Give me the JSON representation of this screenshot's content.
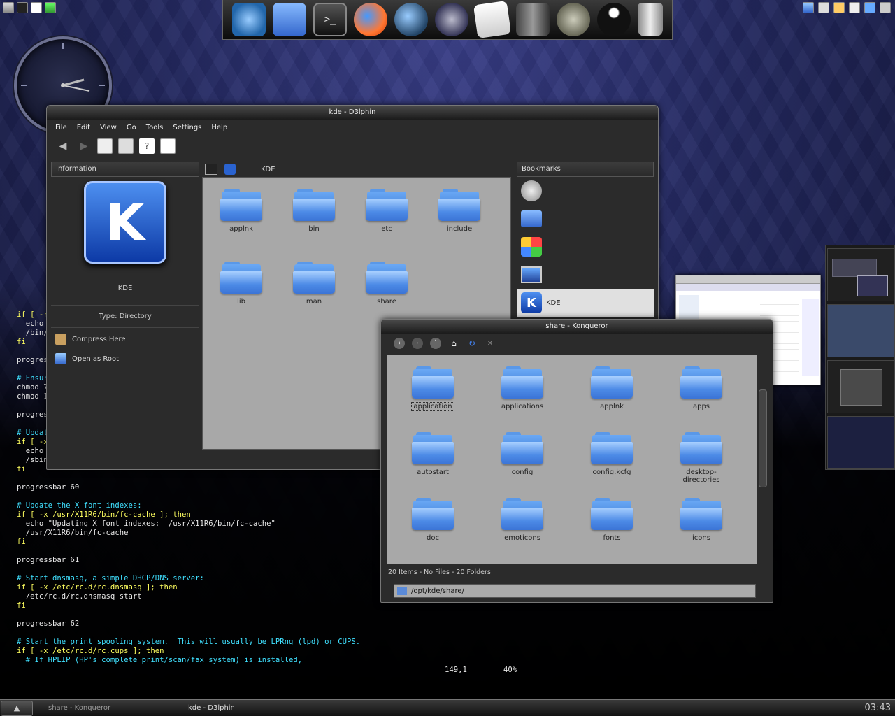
{
  "desktop": {
    "clock_time": "03:43"
  },
  "dock": {
    "icons": [
      "globe-icon",
      "home-folder-icon",
      "terminal-icon",
      "firefox-icon",
      "thunderbird-icon",
      "amarok-icon",
      "text-editor-icon",
      "server-icon",
      "gimp-icon",
      "inkscape-icon",
      "trash-icon"
    ]
  },
  "dolphin": {
    "title": "kde - D3lphin",
    "menu": [
      "File",
      "Edit",
      "View",
      "Go",
      "Tools",
      "Settings",
      "Help"
    ],
    "info_panel": {
      "header": "Information",
      "name": "KDE",
      "type": "Type: Directory",
      "actions": [
        "Compress Here",
        "Open as Root"
      ]
    },
    "location": "KDE",
    "folders": [
      "applnk",
      "bin",
      "etc",
      "include",
      "lib",
      "man",
      "share"
    ],
    "bookmarks": {
      "header": "Bookmarks",
      "items": [
        "",
        "",
        "",
        "",
        "KDE"
      ]
    }
  },
  "konqueror": {
    "title": "share - Konqueror",
    "folders": [
      "application",
      "applications",
      "applnk",
      "apps",
      "autostart",
      "config",
      "config.kcfg",
      "desktop-directories",
      "doc",
      "emoticons",
      "fonts",
      "icons"
    ],
    "status": "20 Items - No Files - 20 Folders",
    "location": "/opt/kde/share/"
  },
  "terminal": {
    "lines": [
      {
        "cls": "t-kw",
        "text": "if [ -r"
      },
      {
        "cls": "",
        "text": "  echo"
      },
      {
        "cls": "",
        "text": "  /bin/"
      },
      {
        "cls": "t-kw",
        "text": "fi"
      },
      {
        "cls": "",
        "text": ""
      },
      {
        "cls": "",
        "text": "progress"
      },
      {
        "cls": "",
        "text": ""
      },
      {
        "cls": "t-cm",
        "text": "# Ensur"
      },
      {
        "cls": "",
        "text": "chmod 7"
      },
      {
        "cls": "",
        "text": "chmod 1"
      },
      {
        "cls": "",
        "text": ""
      },
      {
        "cls": "",
        "text": "progres"
      },
      {
        "cls": "",
        "text": ""
      },
      {
        "cls": "t-cm",
        "text": "# Updat"
      },
      {
        "cls": "t-kw",
        "text": "if [ -x"
      },
      {
        "cls": "",
        "text": "  echo"
      },
      {
        "cls": "",
        "text": "  /sbin"
      },
      {
        "cls": "t-kw",
        "text": "fi"
      },
      {
        "cls": "",
        "text": ""
      },
      {
        "cls": "",
        "text": "progressbar 60"
      },
      {
        "cls": "",
        "text": ""
      },
      {
        "cls": "t-cm",
        "text": "# Update the X font indexes:"
      },
      {
        "cls": "t-kw",
        "text": "if [ -x /usr/X11R6/bin/fc-cache ]; then"
      },
      {
        "cls": "",
        "text": "  echo \"Updating X font indexes:  /usr/X11R6/bin/fc-cache\""
      },
      {
        "cls": "",
        "text": "  /usr/X11R6/bin/fc-cache"
      },
      {
        "cls": "t-kw",
        "text": "fi"
      },
      {
        "cls": "",
        "text": ""
      },
      {
        "cls": "",
        "text": "progressbar 61"
      },
      {
        "cls": "",
        "text": ""
      },
      {
        "cls": "t-cm",
        "text": "# Start dnsmasq, a simple DHCP/DNS server:"
      },
      {
        "cls": "t-kw",
        "text": "if [ -x /etc/rc.d/rc.dnsmasq ]; then"
      },
      {
        "cls": "",
        "text": "  /etc/rc.d/rc.dnsmasq start"
      },
      {
        "cls": "t-kw",
        "text": "fi"
      },
      {
        "cls": "",
        "text": ""
      },
      {
        "cls": "",
        "text": "progressbar 62"
      },
      {
        "cls": "",
        "text": ""
      },
      {
        "cls": "t-cm",
        "text": "# Start the print spooling system.  This will usually be LPRng (lpd) or CUPS."
      },
      {
        "cls": "t-kw",
        "text": "if [ -x /etc/rc.d/rc.cups ]; then"
      },
      {
        "cls": "t-cm",
        "text": "  # If HPLIP (HP's complete print/scan/fax system) is installed,"
      }
    ],
    "cursor_pos": "149,1",
    "percent": "40%"
  },
  "taskbar": {
    "tasks": [
      "share - Konqueror",
      "kde - D3lphin"
    ]
  }
}
